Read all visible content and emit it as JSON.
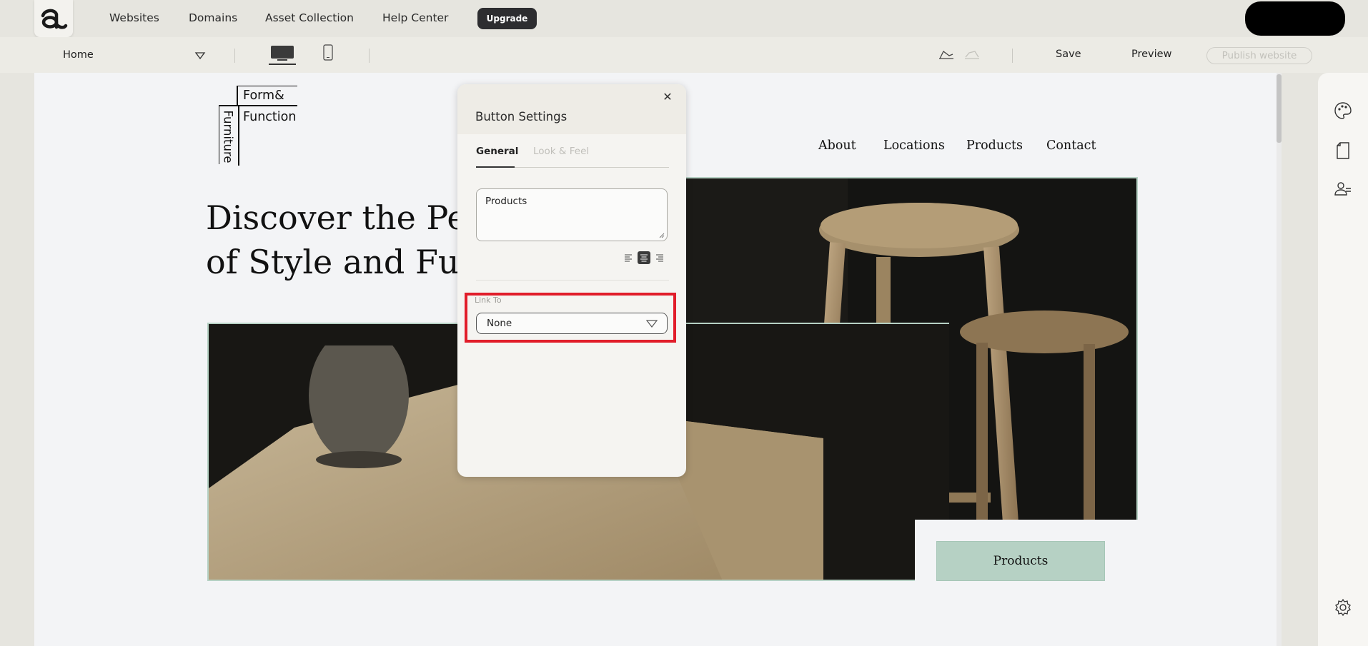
{
  "nav": {
    "items": [
      "Websites",
      "Domains",
      "Asset Collection",
      "Help Center"
    ],
    "upgrade_label": "Upgrade"
  },
  "toolbar": {
    "page": "Home",
    "save_label": "Save",
    "preview_label": "Preview",
    "publish_label": "Publish website"
  },
  "site": {
    "logo_text": [
      "Form&",
      "Function",
      "Furniture"
    ],
    "menu": [
      "About",
      "Locations",
      "Products",
      "Contact"
    ],
    "hero_lines": [
      "Discover the Per",
      "of Style and Fun"
    ],
    "cta_label": "Products"
  },
  "panel": {
    "title": "Button Settings",
    "tabs": [
      "General",
      "Look & Feel"
    ],
    "button_text": "Products",
    "link_label": "Link To",
    "link_value": "None"
  },
  "colors": {
    "accent_green": "#b6d1c4",
    "highlight_red": "#e11d2a",
    "upgrade_bg": "#2d2d30"
  }
}
